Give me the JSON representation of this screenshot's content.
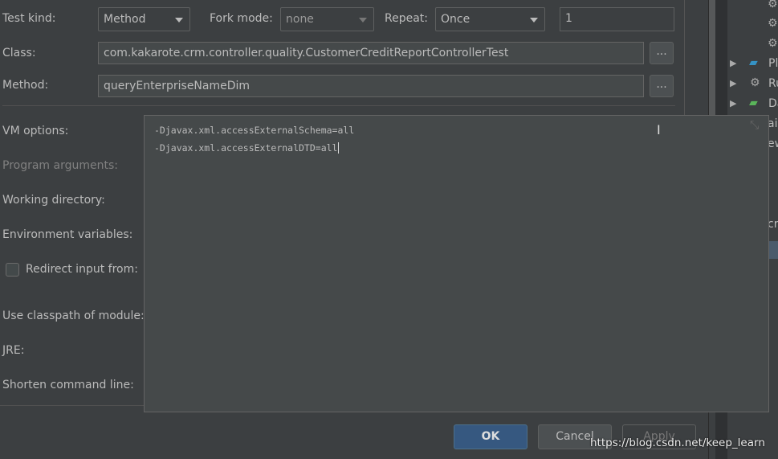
{
  "form": {
    "test_kind_label": "Test kind:",
    "test_kind_value": "Method",
    "fork_mode_label": "Fork mode:",
    "fork_mode_value": "none",
    "repeat_label": "Repeat:",
    "repeat_value": "Once",
    "repeat_count": "1",
    "class_label": "Class:",
    "class_value": "com.kakarote.crm.controller.quality.CustomerCreditReportControllerTest",
    "method_label": "Method:",
    "method_value": "queryEnterpriseNameDim",
    "browse_label": "...",
    "vm_options_label": "VM options:",
    "program_arguments_label": "Program arguments:",
    "working_directory_label": "Working directory:",
    "environment_variables_label": "Environment variables:",
    "redirect_input_label": "Redirect input from:",
    "classpath_label": "Use classpath of module:",
    "jre_label": "JRE:",
    "shorten_label": "Shorten command line:"
  },
  "editor": {
    "lines": [
      "-Djavax.xml.accessExternalSchema=all",
      "-Djavax.xml.accessExternalDTD=all"
    ]
  },
  "buttons": {
    "ok": "OK",
    "cancel": "Cancel",
    "apply": "Apply"
  },
  "side_panel": {
    "items": [
      "Pl",
      "Ru",
      "Da"
    ],
    "fragments": [
      "ail",
      "ew",
      "crn"
    ]
  },
  "watermark": "https://blog.csdn.net/keep_learn"
}
